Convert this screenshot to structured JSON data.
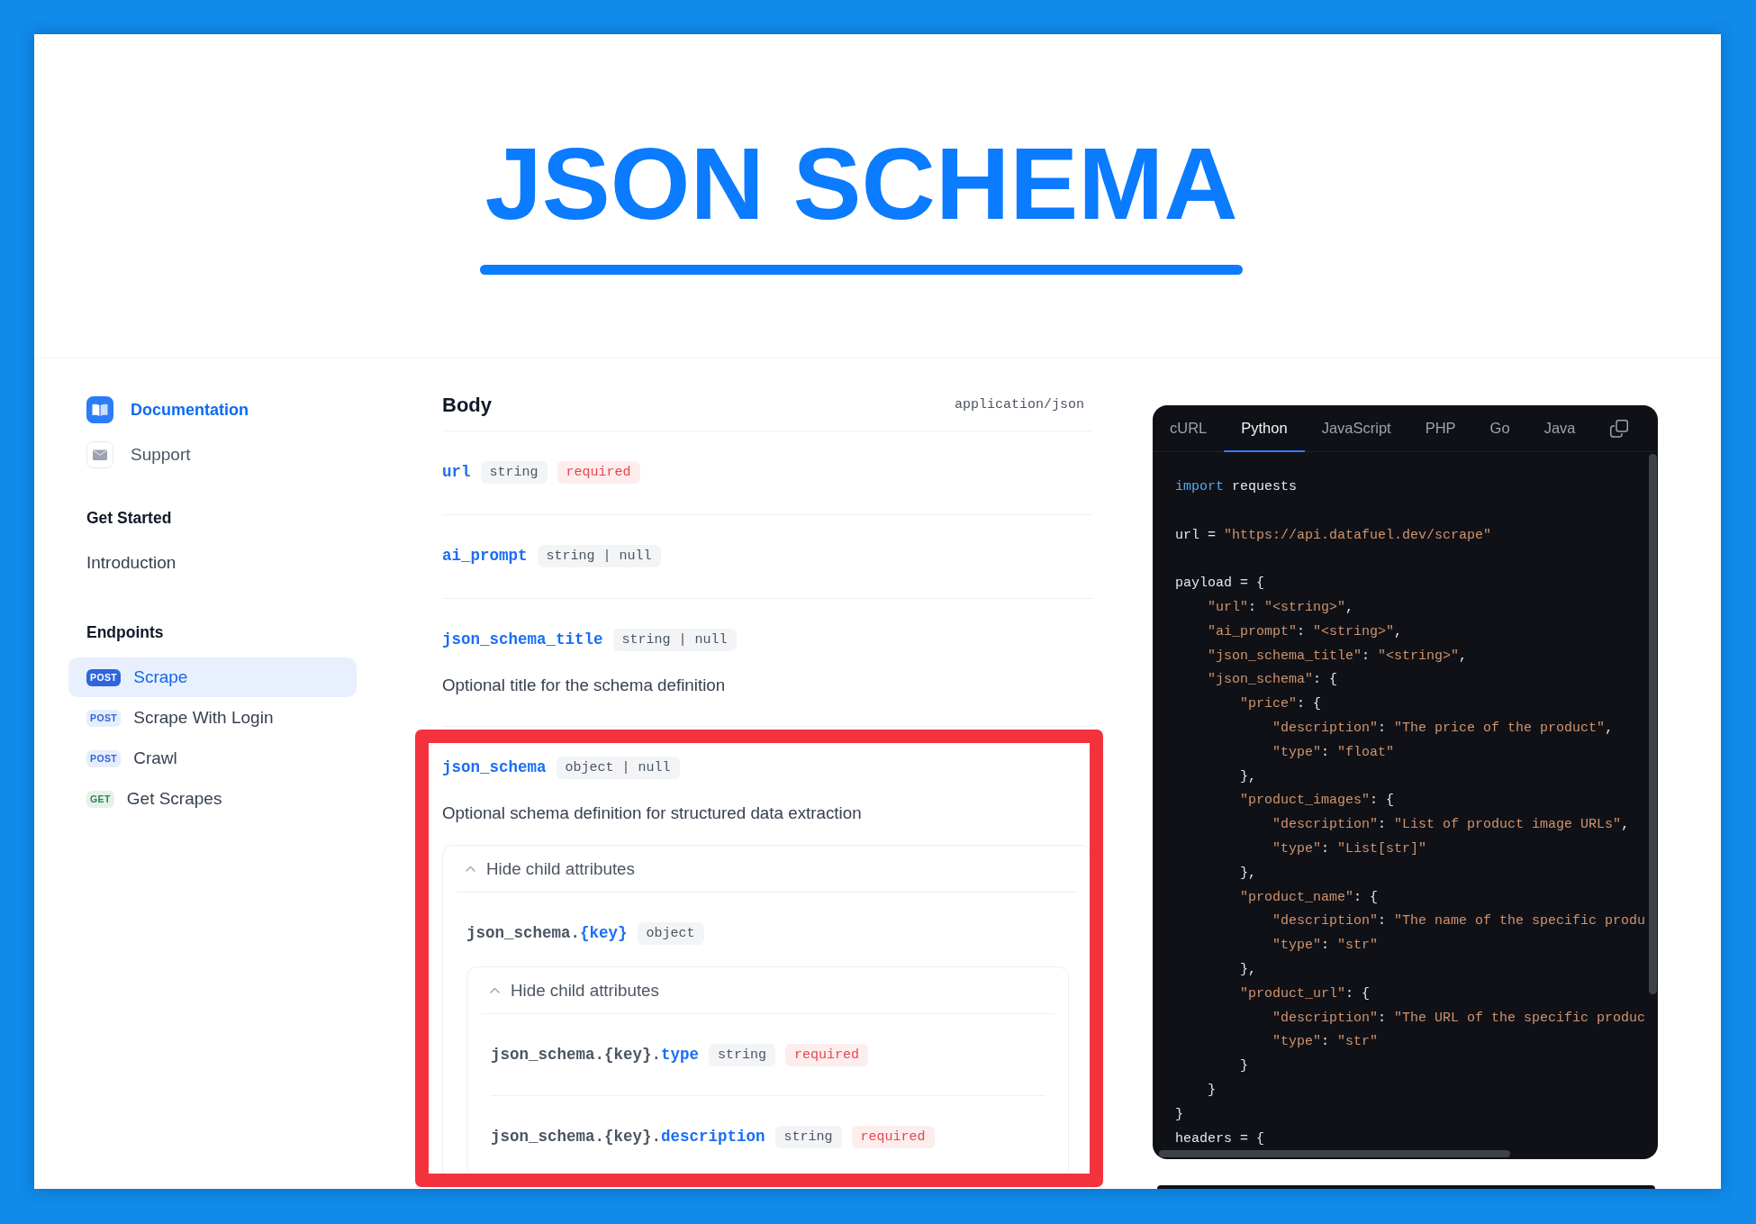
{
  "hero": {
    "title": "JSON SCHEMA"
  },
  "sidebar": {
    "links": [
      {
        "label": "Documentation",
        "kind": "book",
        "selected": true
      },
      {
        "label": "Support",
        "kind": "mail",
        "selected": false
      }
    ],
    "sections": [
      {
        "title": "Get Started",
        "items": [
          {
            "label": "Introduction",
            "selected": false
          }
        ]
      },
      {
        "title": "Endpoints",
        "items": [
          {
            "method": "POST",
            "color": "#2f66dc",
            "label": "Scrape",
            "selected": true
          },
          {
            "method": "POST",
            "color": "#2f66dc",
            "label": "Scrape With Login",
            "selected": false
          },
          {
            "method": "POST",
            "color": "#2f66dc",
            "label": "Crawl",
            "selected": false
          },
          {
            "method": "GET",
            "color": "#23894a",
            "label": "Get Scrapes",
            "selected": false
          }
        ]
      }
    ]
  },
  "body": {
    "title": "Body",
    "content_type": "application/json",
    "fields": [
      {
        "name": "url",
        "badges": [
          {
            "kind": "type",
            "text": "string"
          },
          {
            "kind": "required",
            "text": "required"
          }
        ],
        "highlighted": false
      },
      {
        "name": "ai_prompt",
        "badges": [
          {
            "kind": "type",
            "text": "string | null"
          }
        ],
        "highlighted": false
      },
      {
        "name": "json_schema_title",
        "badges": [
          {
            "kind": "type",
            "text": "string | null"
          }
        ],
        "description": "Optional title for the schema definition",
        "highlighted": false
      },
      {
        "name": "json_schema",
        "badges": [
          {
            "kind": "type",
            "text": "object | null"
          }
        ],
        "description": "Optional schema definition for structured data extraction",
        "highlighted": true,
        "children": {
          "toggle": "Hide child attributes",
          "expanded": true,
          "fields": [
            {
              "prefix": "json_schema.",
              "name": "{key}",
              "badges": [
                {
                  "kind": "type",
                  "text": "object"
                }
              ],
              "children": {
                "toggle": "Hide child attributes",
                "expanded": true,
                "fields": [
                  {
                    "prefix": "json_schema.{key}.",
                    "name": "type",
                    "badges": [
                      {
                        "kind": "type",
                        "text": "string"
                      },
                      {
                        "kind": "required",
                        "text": "required"
                      }
                    ]
                  },
                  {
                    "prefix": "json_schema.{key}.",
                    "name": "description",
                    "badges": [
                      {
                        "kind": "type",
                        "text": "string"
                      },
                      {
                        "kind": "required",
                        "text": "required"
                      }
                    ]
                  }
                ]
              }
            }
          ]
        }
      }
    ]
  },
  "code_panel": {
    "tabs": [
      {
        "label": "cURL",
        "selected": false
      },
      {
        "label": "Python",
        "selected": true
      },
      {
        "label": "JavaScript",
        "selected": false
      },
      {
        "label": "PHP",
        "selected": false
      },
      {
        "label": "Go",
        "selected": false
      },
      {
        "label": "Java",
        "selected": false
      }
    ],
    "code": {
      "blocks": [
        [
          {
            "keyword": "import",
            "text": " requests"
          }
        ],
        [
          "url = \"https://api.datafuel.dev/scrape\""
        ],
        [
          "payload = {",
          "    \"url\": \"<string>\",",
          "    \"ai_prompt\": \"<string>\",",
          "    \"json_schema_title\": \"<string>\",",
          "    \"json_schema\": {",
          "        \"price\": {",
          "            \"description\": \"The price of the product\",",
          "            \"type\": \"float\"",
          "        },",
          "        \"product_images\": {",
          "            \"description\": \"List of product image URLs\",",
          "            \"type\": \"List[str]\"",
          "        },",
          "        \"product_name\": {",
          "            \"description\": \"The name of the specific produ",
          "            \"type\": \"str\"",
          "        },",
          "        \"product_url\": {",
          "            \"description\": \"The URL of the specific produc",
          "            \"type\": \"str\"",
          "        }",
          "    }",
          "}",
          "headers = {"
        ]
      ]
    }
  }
}
